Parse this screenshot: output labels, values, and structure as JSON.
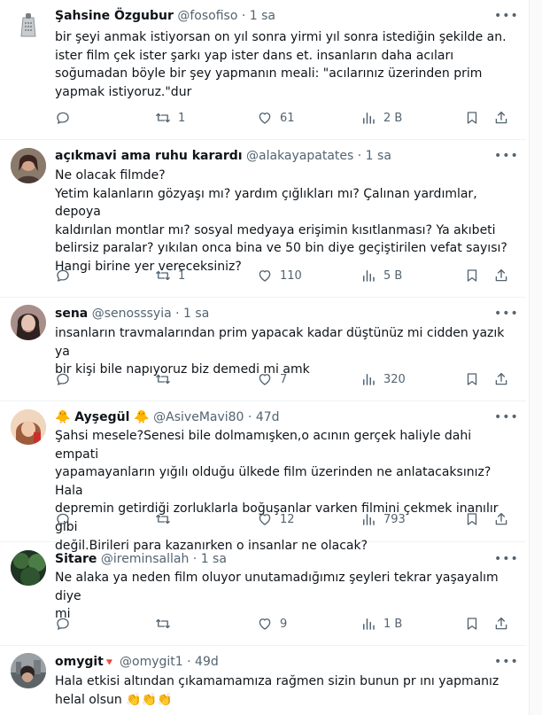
{
  "tweets": [
    {
      "display_name": "Şahsine Özgubur",
      "handle": "@fosofiso",
      "time": "1 sa",
      "text": "bir şeyi anmak istiyorsan on yıl sonra yirmi yıl sonra istediğin şekilde an.\nister film çek ister şarkı yap ister dans et. insanların daha acıları\nsoğumadan böyle bir şey yapmanın meali: \"acılarınız üzerinden prim\nyapmak istiyoruz.\"dur",
      "replies": "",
      "retweets": "1",
      "likes": "61",
      "views": "2 B",
      "avatar": "grater-photo"
    },
    {
      "display_name": "açıkmavi ama ruhu karardı",
      "handle": "@alakayapatates",
      "time": "1 sa",
      "text": "Ne olacak filmde?\nYetim kalanların gözyaşı mı? yardım çığlıkları mı? Çalınan yardımlar, depoya\nkaldırılan montlar mı? sosyal medyaya erişimin kısıtlanması? Ya akıbeti\nbelirsiz paralar? yıkılan onca bina ve 50 bin diye geçiştirilen vefat sayısı?\nHangi birine yer vereceksiniz?",
      "replies": "",
      "retweets": "1",
      "likes": "110",
      "views": "5 B",
      "avatar": "woman-photo"
    },
    {
      "display_name": "sena",
      "handle": "@senosssyia",
      "time": "1 sa",
      "text": "insanların travmalarından prim yapacak kadar düştünüz mi cidden yazık ya\nbir kişi bile napıyoruz biz demedi mi amk",
      "replies": "",
      "retweets": "",
      "likes": "7",
      "views": "320",
      "avatar": "portrait-photo"
    },
    {
      "display_name": "🐥 Ayşegül 🐥",
      "handle": "@AsiveMavi80",
      "time": "47d",
      "text": "Şahsi mesele?Senesi bile dolmamışken,o acının gerçek haliyle dahi empati\nyapamayanların yığılı olduğu ülkede film üzerinden ne anlatacaksınız?Hala\ndepremin getirdiği zorluklarla boğuşanlar varken filmini çekmek inanılır gibi\ndeğil.Birileri para kazanırken o insanlar ne olacak?",
      "replies": "",
      "retweets": "",
      "likes": "12",
      "views": "793",
      "avatar": "warm-photo"
    },
    {
      "display_name": "Sitare",
      "handle": "@ireminsallah",
      "time": "1 sa",
      "text": "Ne alaka ya neden film oluyor unutamadığımız şeyleri tekrar yaşayalım diye\nmi",
      "replies": "",
      "retweets": "",
      "likes": "9",
      "views": "1 B",
      "avatar": "green-photo"
    },
    {
      "display_name": "omygit",
      "name_badge": "🔻",
      "handle": "@omygit1",
      "time": "49d",
      "text": "Hala etkisi altından çıkamamamıza rağmen sizin bunun pr ını yapmanız\nhelal olsun 👏👏👏",
      "avatar": "city-photo"
    }
  ],
  "separator": "·",
  "colors": {
    "secondary_text": "#536471",
    "divider": "#eff3f4",
    "primary_text": "#0f1419"
  },
  "icons": [
    "reply-icon",
    "retweet-icon",
    "like-icon",
    "views-icon",
    "bookmark-icon",
    "share-icon",
    "more-icon"
  ]
}
